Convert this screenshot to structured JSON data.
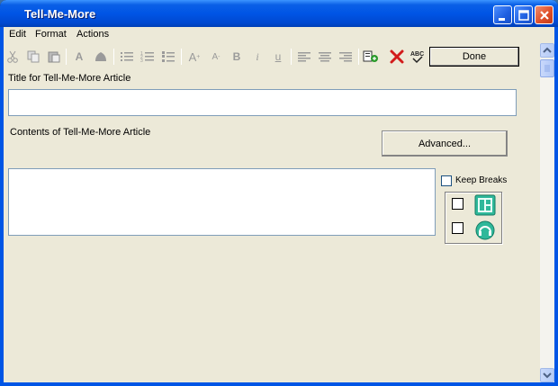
{
  "window": {
    "title": "Tell-Me-More"
  },
  "menu": {
    "items": [
      "Edit",
      "Format",
      "Actions"
    ]
  },
  "toolbar": {
    "icons": [
      "cut-icon",
      "copy-icon",
      "paste-icon",
      "font-color-icon",
      "highlight-icon",
      "bullet-list-icon",
      "numbered-list-icon",
      "outline-list-icon",
      "font-grow-icon",
      "font-shrink-icon",
      "bold-icon",
      "italic-icon",
      "underline-icon",
      "align-left-icon",
      "align-center-icon",
      "align-right-icon",
      "insert-link-icon",
      "delete-icon",
      "spell-check-icon"
    ],
    "done_label": "Done"
  },
  "form": {
    "title_label": "Title for Tell-Me-More Article",
    "title_value": "",
    "contents_label": "Contents of Tell-Me-More Article",
    "contents_value": "",
    "advanced_label": "Advanced...",
    "keep_breaks_label": "Keep Breaks"
  },
  "colors": {
    "titlebar": "#0055e5",
    "background": "#ece9d8",
    "delete_red": "#d21b1b",
    "teal_icon": "#20a88a"
  }
}
